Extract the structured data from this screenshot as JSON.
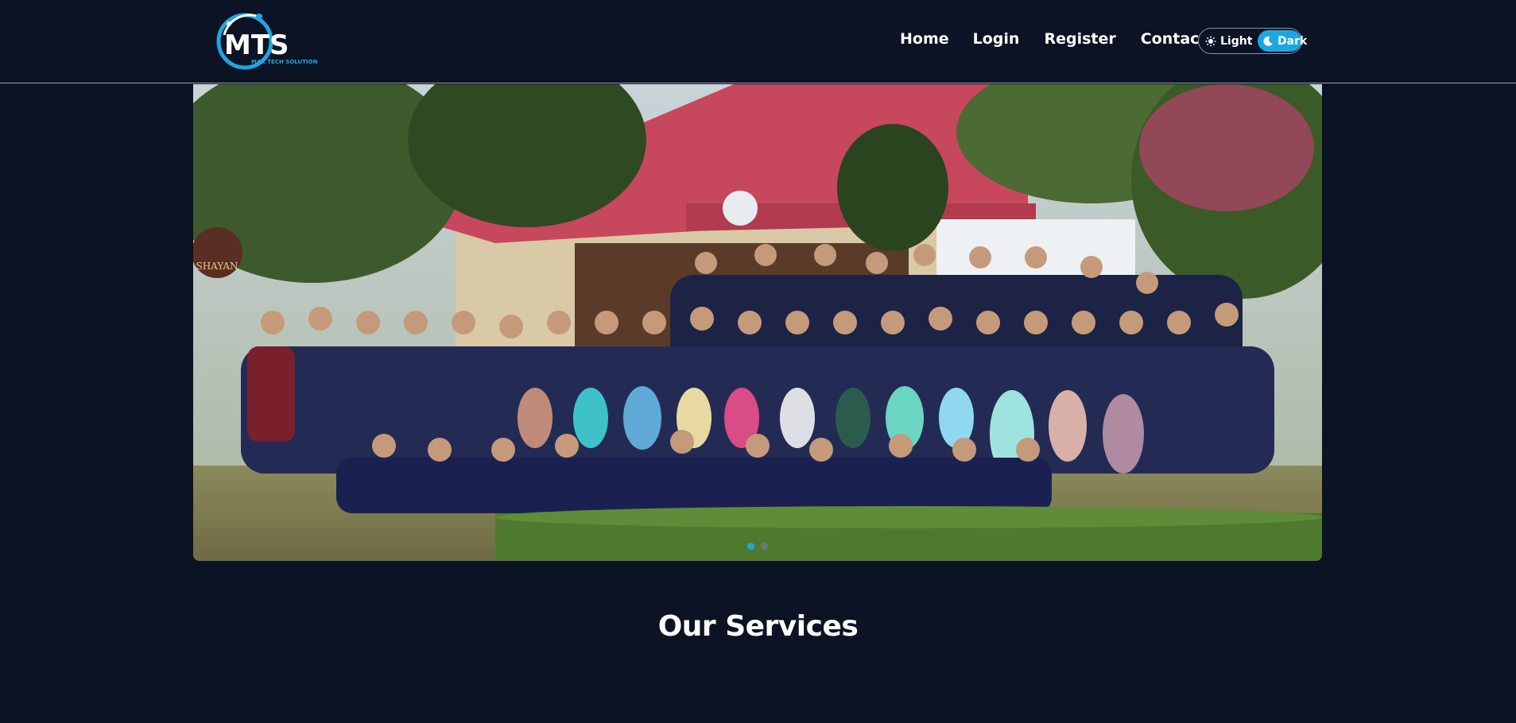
{
  "brand": {
    "logo_text": "MTS",
    "logo_subtext": "MAK TECH SOLUTION",
    "accent": "#1ea6e0"
  },
  "nav": {
    "items": [
      {
        "label": "Home"
      },
      {
        "label": "Login"
      },
      {
        "label": "Register"
      },
      {
        "label": "Contact"
      }
    ]
  },
  "theme": {
    "light_label": "Light",
    "dark_label": "Dark",
    "selected": "Dark",
    "light_icon": "sun-icon",
    "dark_icon": "moon-icon"
  },
  "carousel": {
    "slide_count": 2,
    "active_index": 0,
    "sign_text": "SHAYAN"
  },
  "sections": {
    "services_title": "Our Services"
  }
}
